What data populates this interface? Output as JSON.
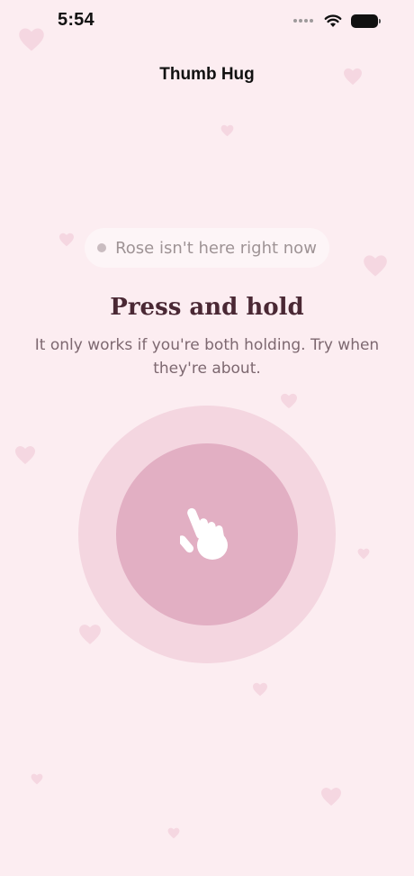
{
  "status_bar": {
    "time": "5:54",
    "icons": [
      "signal-dots-icon",
      "wifi-icon",
      "battery-icon"
    ]
  },
  "nav": {
    "title": "Thumb Hug"
  },
  "presence": {
    "text": "Rose isn't here right now",
    "status": "offline"
  },
  "prompt": {
    "heading": "Press and hold",
    "subtext": "It only works if you're both holding. Try when they're about."
  },
  "hold_button": {
    "icon": "hand-pointer-icon"
  },
  "colors": {
    "background": "#fcedf1",
    "outer_ring": "#f4d6e0",
    "inner_circle": "#e2afc3",
    "heading": "#4a2834",
    "decorative_heart": "#f3d0dc"
  }
}
